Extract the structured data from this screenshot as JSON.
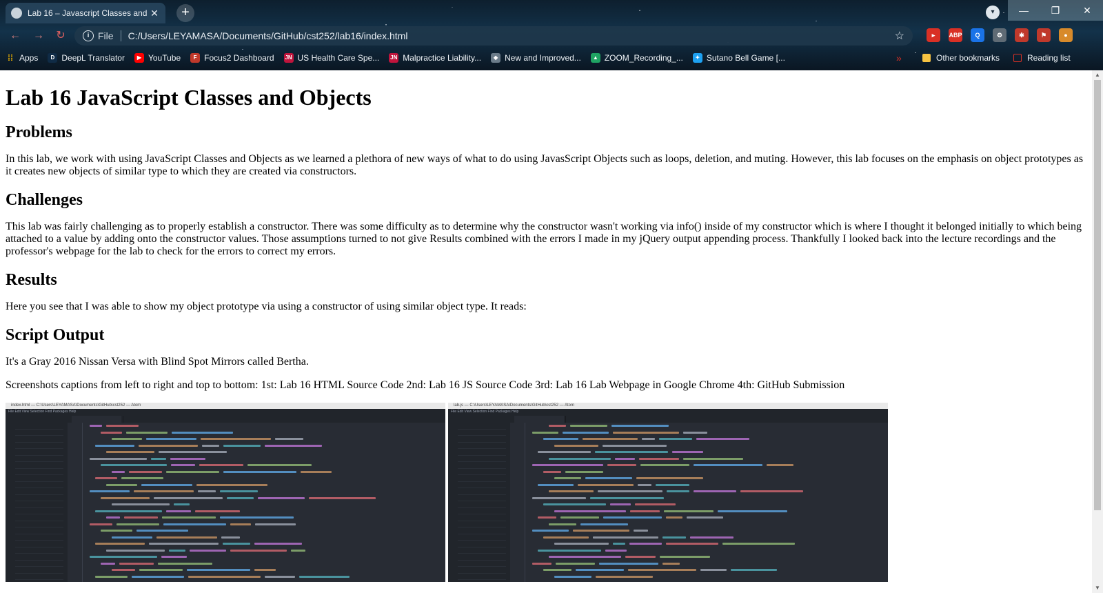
{
  "tab": {
    "title": "Lab 16 – Javascript Classes and C",
    "close_glyph": "✕"
  },
  "new_tab_glyph": "+",
  "window_controls": {
    "minimize": "—",
    "maximize": "❐",
    "close": "✕"
  },
  "toolbar": {
    "back": "←",
    "forward": "→",
    "reload": "↻",
    "info": "i",
    "scheme_label": "File",
    "url": "C:/Users/LEYAMASA/Documents/GitHub/cst252/lab16/index.html",
    "star": "☆"
  },
  "extensions": [
    {
      "name": "ext-red-icon",
      "label": "▸",
      "color": "#d93025"
    },
    {
      "name": "abp-icon",
      "label": "ABP",
      "color": "#d93025"
    },
    {
      "name": "search-ext-icon",
      "label": "Q",
      "color": "#1a73e8"
    },
    {
      "name": "gear-icon",
      "label": "⚙",
      "color": "#5f6b75"
    },
    {
      "name": "puzzle-icon",
      "label": "✱",
      "color": "#c0392b"
    },
    {
      "name": "ext-flag-icon",
      "label": "⚑",
      "color": "#c0392b"
    },
    {
      "name": "avatar-icon",
      "label": "●",
      "color": "#d88a2a"
    }
  ],
  "bookmarks": {
    "apps_label": "Apps",
    "items": [
      {
        "label": "DeepL Translator",
        "icon": "deepl-icon",
        "color": "#0f2b46",
        "glyph": "D"
      },
      {
        "label": "YouTube",
        "icon": "youtube-icon",
        "color": "#ff0000",
        "glyph": "▶"
      },
      {
        "label": "Focus2 Dashboard",
        "icon": "focus2-icon",
        "color": "#c0392b",
        "glyph": "F"
      },
      {
        "label": "US Health Care Spe...",
        "icon": "jn-icon",
        "color": "#c0143c",
        "glyph": "JN"
      },
      {
        "label": "Malpractice Liability...",
        "icon": "jn-icon",
        "color": "#c0143c",
        "glyph": "JN"
      },
      {
        "label": "New and Improved...",
        "icon": "diamond-icon",
        "color": "#6b7c8a",
        "glyph": "◆"
      },
      {
        "label": "ZOOM_Recording_...",
        "icon": "drive-icon",
        "color": "#1fa463",
        "glyph": "▲"
      },
      {
        "label": "Sutano Bell Game [...",
        "icon": "twitter-icon",
        "color": "#1da1f2",
        "glyph": "✦"
      }
    ],
    "more_glyph": "»",
    "other_label": "Other bookmarks",
    "reading_label": "Reading list"
  },
  "content": {
    "h1": "Lab 16 JavaScript Classes and Objects",
    "problems_heading": "Problems",
    "problems_text": "In this lab, we work with using JavaScript Classes and Objects as we learned a plethora of new ways of what to do using JavasScript Objects such as loops, deletion, and muting. However, this lab focuses on the emphasis on object prototypes as it creates new objects of similar type to which they are created via constructors.",
    "challenges_heading": "Challenges",
    "challenges_text": "This lab was fairly challenging as to properly establish a constructor. There was some difficulty as to determine why the constructor wasn't working via info() inside of my constructor which is where I thought it belonged initially to which being attached to a value by adding onto the constructor values. Those assumptions turned to not give Results combined with the errors I made in my jQuery output appending process. Thankfully I looked back into the lecture recordings and the professor's webpage for the lab to check for the errors to correct my errors.",
    "results_heading": "Results",
    "results_text": "Here you see that I was able to show my object prototype via using a constructor of using similar object type. It reads:",
    "output_heading": "Script Output",
    "output_text": "It's a Gray 2016 Nissan Versa with Blind Spot Mirrors called Bertha.",
    "captions_text": "Screenshots captions from left to right and top to bottom: 1st: Lab 16 HTML Source Code 2nd: Lab 16 JS Source Code 3rd: Lab 16 Lab Webpage in Google Chrome 4th: GitHub Submission"
  },
  "screenshots": [
    {
      "window_title": "index.html — C:\\Users\\LEYAMASA\\Documents\\GitHub\\cst252 — Atom",
      "menu": "File  Edit  View  Selection  Find  Packages  Help"
    },
    {
      "window_title": "lab.js — C:\\Users\\LEYAMASA\\Documents\\GitHub\\cst252 — Atom",
      "menu": "File  Edit  View  Selection  Find  Packages  Help"
    }
  ],
  "scrollbar": {
    "up": "▲",
    "down": "▼"
  }
}
